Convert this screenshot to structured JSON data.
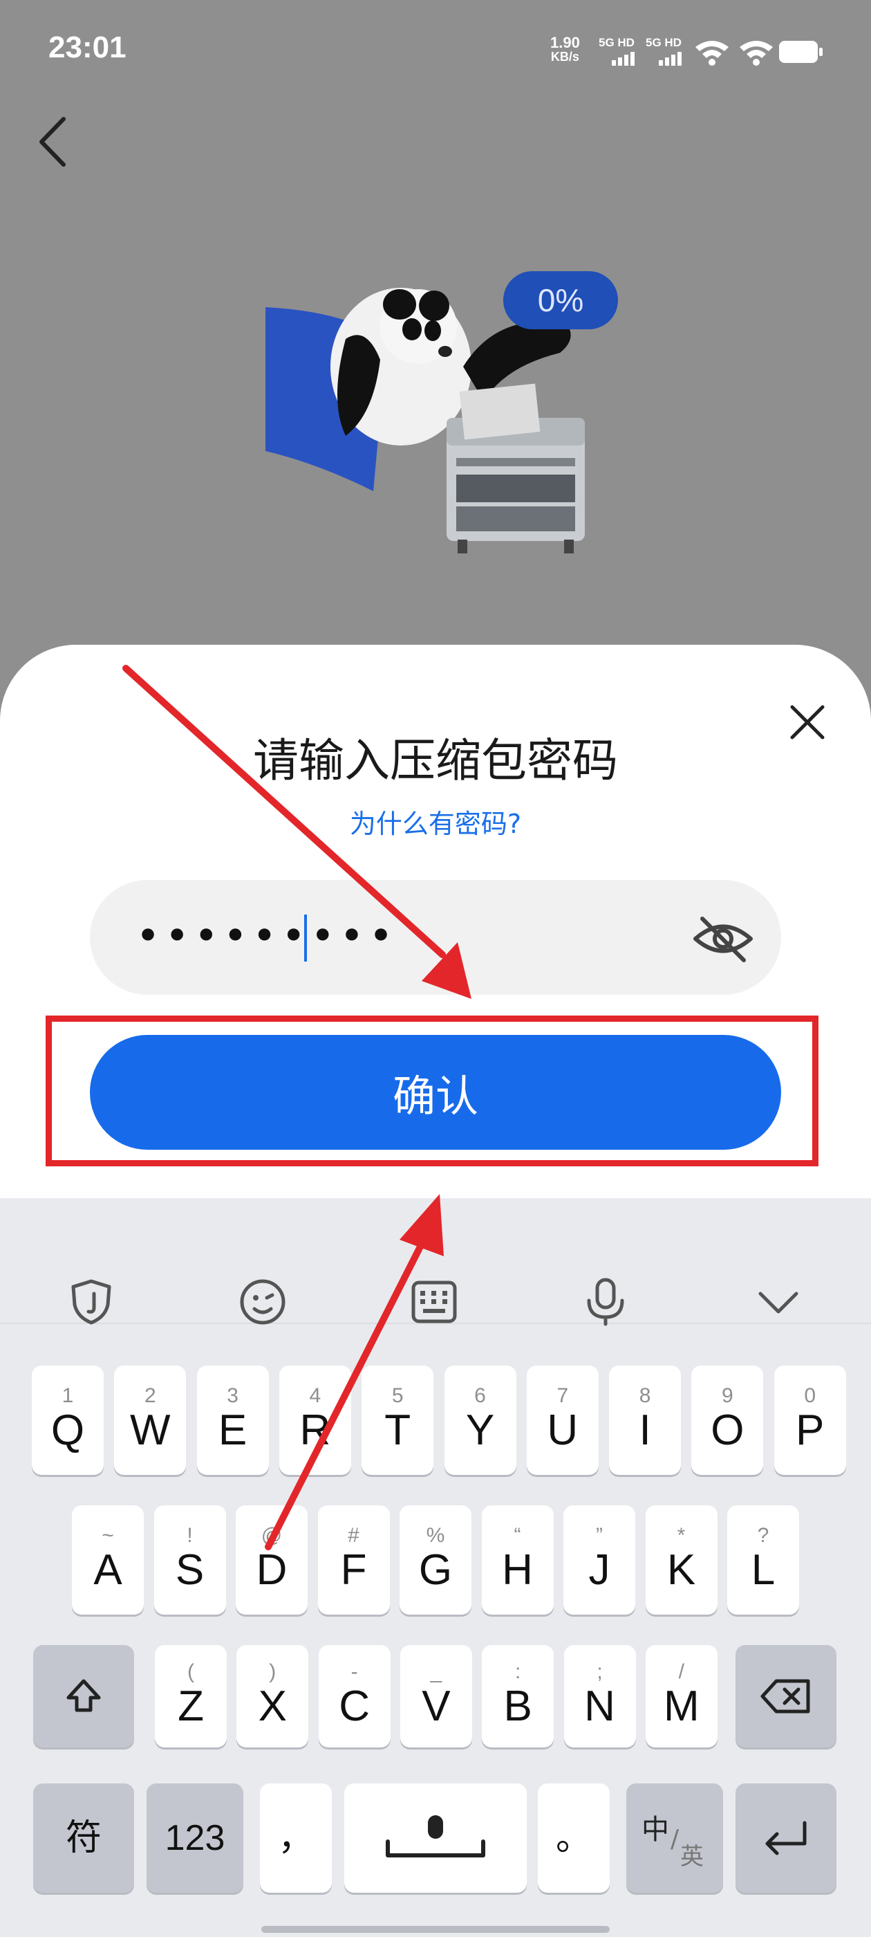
{
  "status_bar": {
    "time": "23:01",
    "net_speed_value": "1.90",
    "net_speed_unit": "KB/s",
    "sim1_label": "5G HD",
    "sim2_label": "5G HD"
  },
  "illustration": {
    "progress": "0%"
  },
  "dialog": {
    "title": "请输入压缩包密码",
    "why_link": "为什么有密码?",
    "password_value": "•••••••••",
    "confirm_label": "确认"
  },
  "keyboard": {
    "toolbar_icons": [
      "shield-icon",
      "emoji-icon",
      "keyboard-icon",
      "microphone-icon",
      "chevron-down-icon"
    ],
    "row1": [
      {
        "sub": "1",
        "main": "Q"
      },
      {
        "sub": "2",
        "main": "W"
      },
      {
        "sub": "3",
        "main": "E"
      },
      {
        "sub": "4",
        "main": "R"
      },
      {
        "sub": "5",
        "main": "T"
      },
      {
        "sub": "6",
        "main": "Y"
      },
      {
        "sub": "7",
        "main": "U"
      },
      {
        "sub": "8",
        "main": "I"
      },
      {
        "sub": "9",
        "main": "O"
      },
      {
        "sub": "0",
        "main": "P"
      }
    ],
    "row2": [
      {
        "sub": "~",
        "main": "A"
      },
      {
        "sub": "!",
        "main": "S"
      },
      {
        "sub": "@",
        "main": "D"
      },
      {
        "sub": "#",
        "main": "F"
      },
      {
        "sub": "%",
        "main": "G"
      },
      {
        "sub": "“",
        "main": "H"
      },
      {
        "sub": "”",
        "main": "J"
      },
      {
        "sub": "*",
        "main": "K"
      },
      {
        "sub": "?",
        "main": "L"
      }
    ],
    "row3": [
      {
        "sub": "(",
        "main": "Z"
      },
      {
        "sub": ")",
        "main": "X"
      },
      {
        "sub": "-",
        "main": "C"
      },
      {
        "sub": "_",
        "main": "V"
      },
      {
        "sub": ":",
        "main": "B"
      },
      {
        "sub": ";",
        "main": "N"
      },
      {
        "sub": "/",
        "main": "M"
      }
    ],
    "symbol_key": "符",
    "number_key": "123",
    "comma_key": "，",
    "period_key": "。",
    "lang_key_main": "中",
    "lang_key_sub": "英"
  },
  "colors": {
    "accent": "#176bea",
    "annotation_red": "#e3262a",
    "badge": "#1f4fb7"
  }
}
